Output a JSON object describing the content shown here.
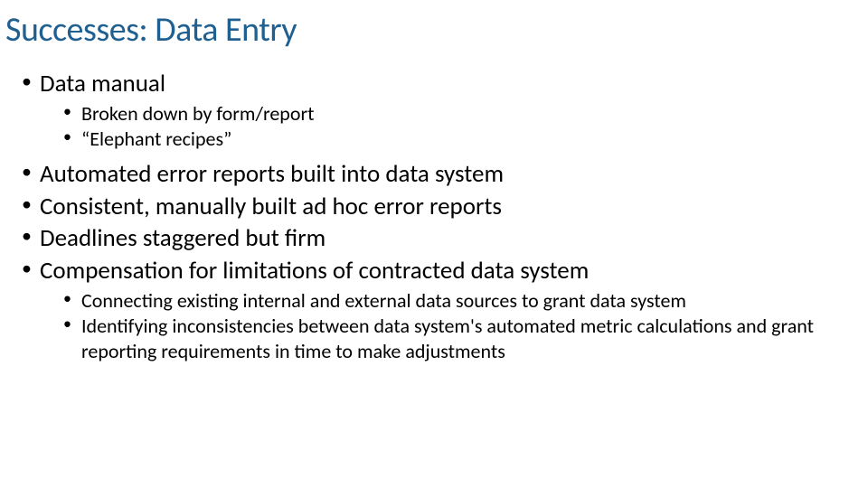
{
  "slide": {
    "title": "Successes: Data Entry",
    "bullets": {
      "b1": "Data manual",
      "b1a": "Broken down by form/report",
      "b1b": "“Elephant recipes”",
      "b2": "Automated error reports built into data system",
      "b3": "Consistent, manually built ad hoc error reports",
      "b4": "Deadlines staggered but firm",
      "b5": "Compensation for limitations of contracted data system",
      "b5a": "Connecting existing internal and external data sources to grant data system",
      "b5b": "Identifying inconsistencies between data system's automated metric calculations and grant reporting requirements in time to make adjustments"
    }
  }
}
